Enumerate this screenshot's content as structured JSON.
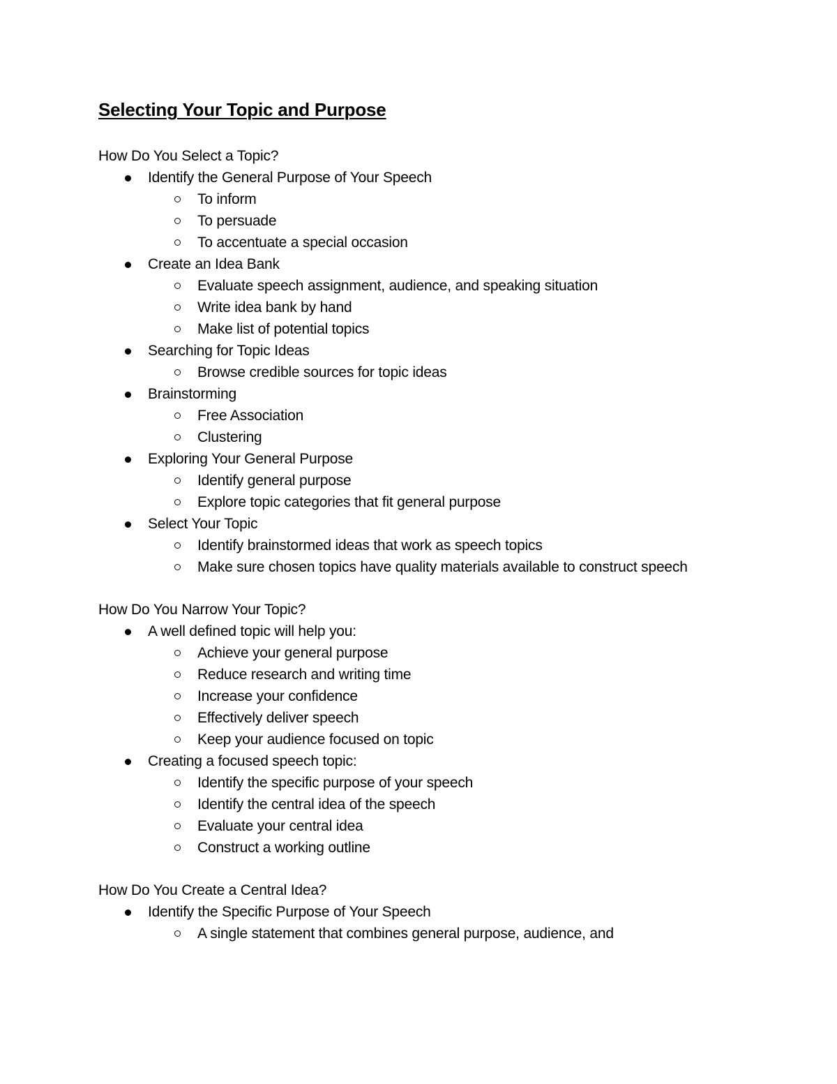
{
  "document": {
    "title": "Selecting Your Topic and Purpose",
    "sections": [
      {
        "heading": "How Do You Select a Topic?",
        "items": [
          {
            "text": "Identify the General Purpose of Your Speech",
            "subitems": [
              "To inform",
              "To persuade",
              "To accentuate a special occasion"
            ]
          },
          {
            "text": "Create an Idea Bank",
            "subitems": [
              "Evaluate speech assignment, audience, and speaking situation",
              "Write idea bank by hand",
              "Make list of potential topics"
            ]
          },
          {
            "text": "Searching for Topic Ideas",
            "subitems": [
              "Browse credible sources for topic ideas"
            ]
          },
          {
            "text": "Brainstorming",
            "subitems": [
              "Free Association",
              "Clustering"
            ]
          },
          {
            "text": "Exploring Your General Purpose",
            "subitems": [
              "Identify general purpose",
              "Explore topic categories that fit general purpose"
            ]
          },
          {
            "text": "Select Your Topic",
            "subitems": [
              "Identify brainstormed ideas that work as speech topics",
              "Make sure chosen topics have quality materials available to construct speech"
            ]
          }
        ]
      },
      {
        "heading": "How Do You Narrow Your Topic?",
        "items": [
          {
            "text": "A well defined topic will help you:",
            "subitems": [
              "Achieve your general purpose",
              "Reduce research and writing time",
              "Increase your confidence",
              "Effectively deliver speech",
              "Keep your audience focused on topic"
            ]
          },
          {
            "text": "Creating a focused speech topic:",
            "subitems": [
              "Identify the specific purpose of your speech",
              "Identify the central idea of the speech",
              "Evaluate your central idea",
              "Construct a working outline"
            ]
          }
        ]
      },
      {
        "heading": "How Do You Create a Central Idea?",
        "items": [
          {
            "text": "Identify the Specific Purpose of Your Speech",
            "subitems": [
              "A single statement that combines general purpose, audience, and"
            ]
          }
        ]
      }
    ]
  }
}
